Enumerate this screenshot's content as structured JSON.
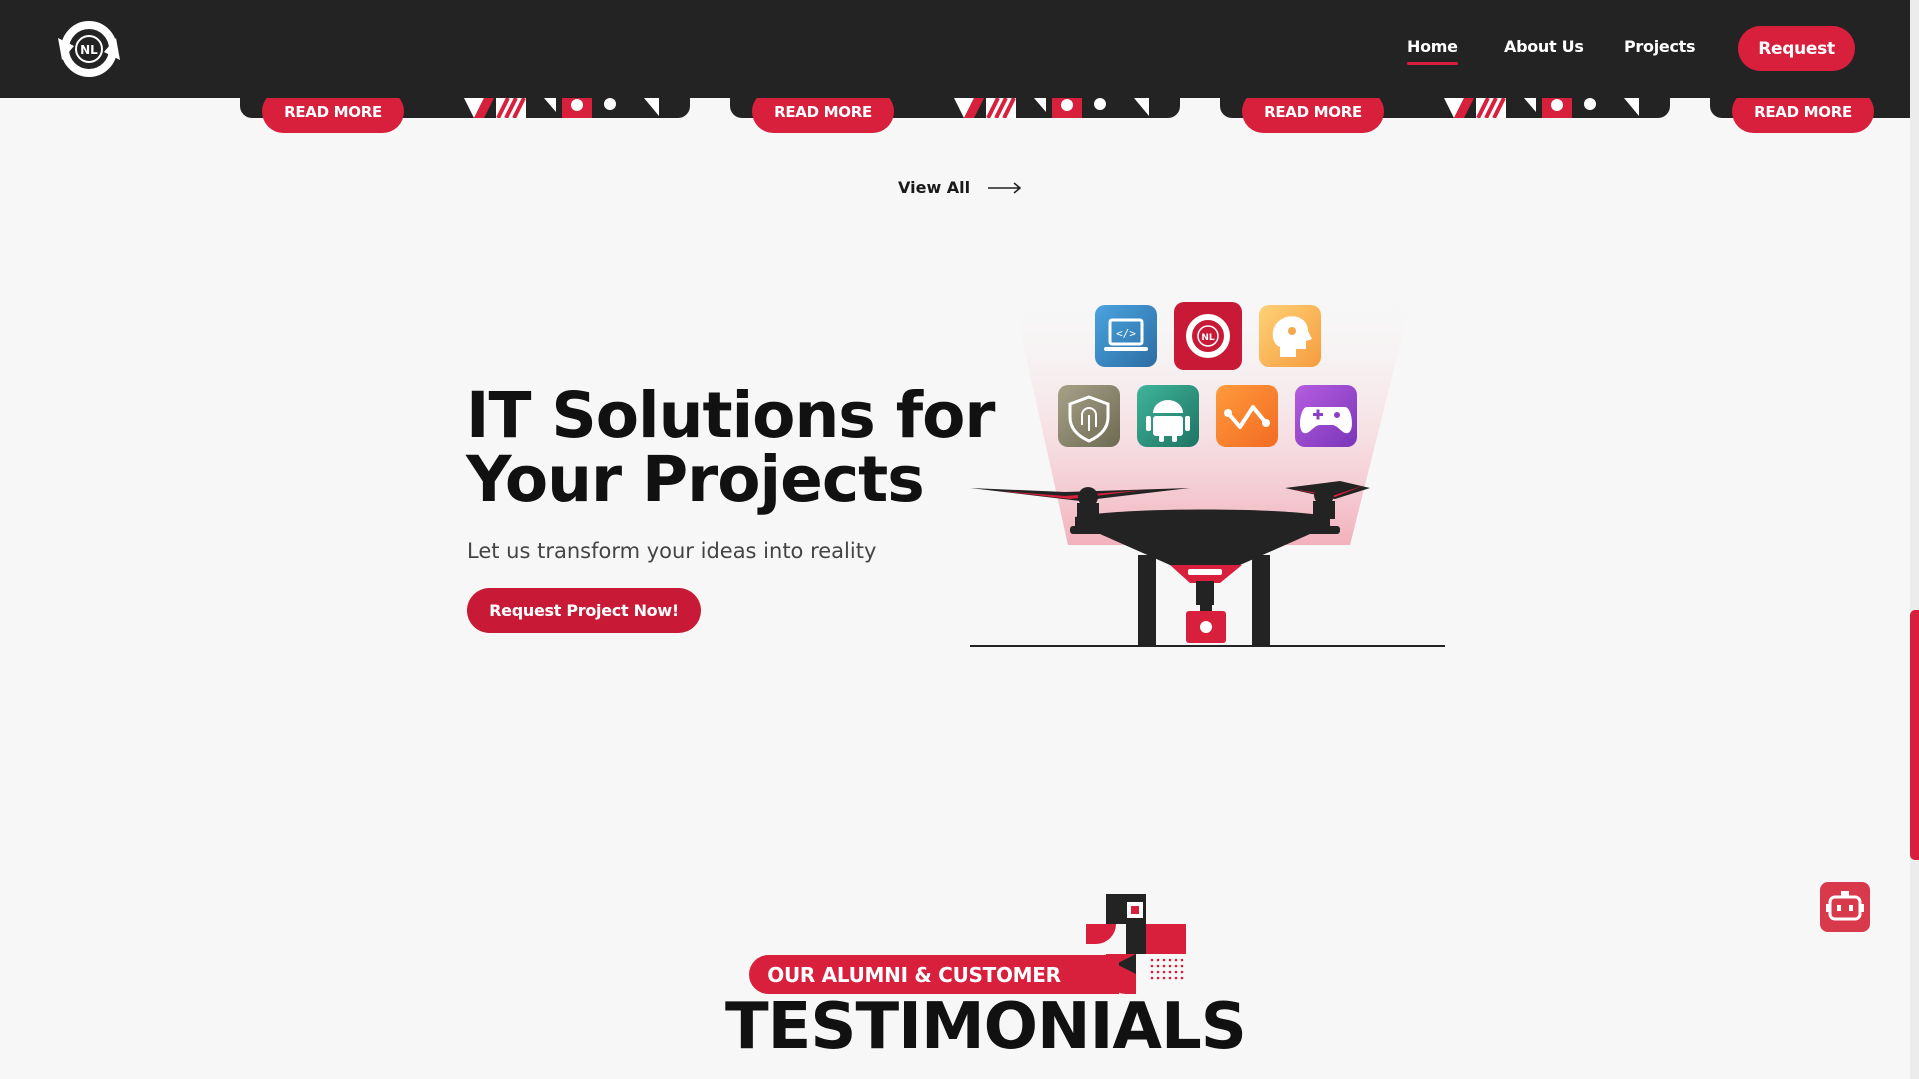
{
  "nav": {
    "logo_text": "NL",
    "links": [
      "Home",
      "About Us",
      "Projects"
    ],
    "active": "Home",
    "cta": "Request"
  },
  "cards": {
    "read_more_label": "READ MORE"
  },
  "view_all": "View All",
  "hero": {
    "title_line1": "IT Solutions for",
    "title_line2": "Your Projects",
    "subtitle": "Let us transform your ideas into reality",
    "cta": "Request Project Now!",
    "app_icons": [
      "code-laptop-icon",
      "nl-logo-icon",
      "ai-head-icon",
      "security-fingerprint-icon",
      "android-icon",
      "data-analytics-icon",
      "gamepad-icon"
    ]
  },
  "testimonials": {
    "banner": "OUR ALUMNI & CUSTOMER",
    "title": "TESTIMONIALS"
  },
  "colors": {
    "brand_red": "#d81f3c",
    "nav_bg": "#232323",
    "page_bg": "#f7f7f7"
  }
}
